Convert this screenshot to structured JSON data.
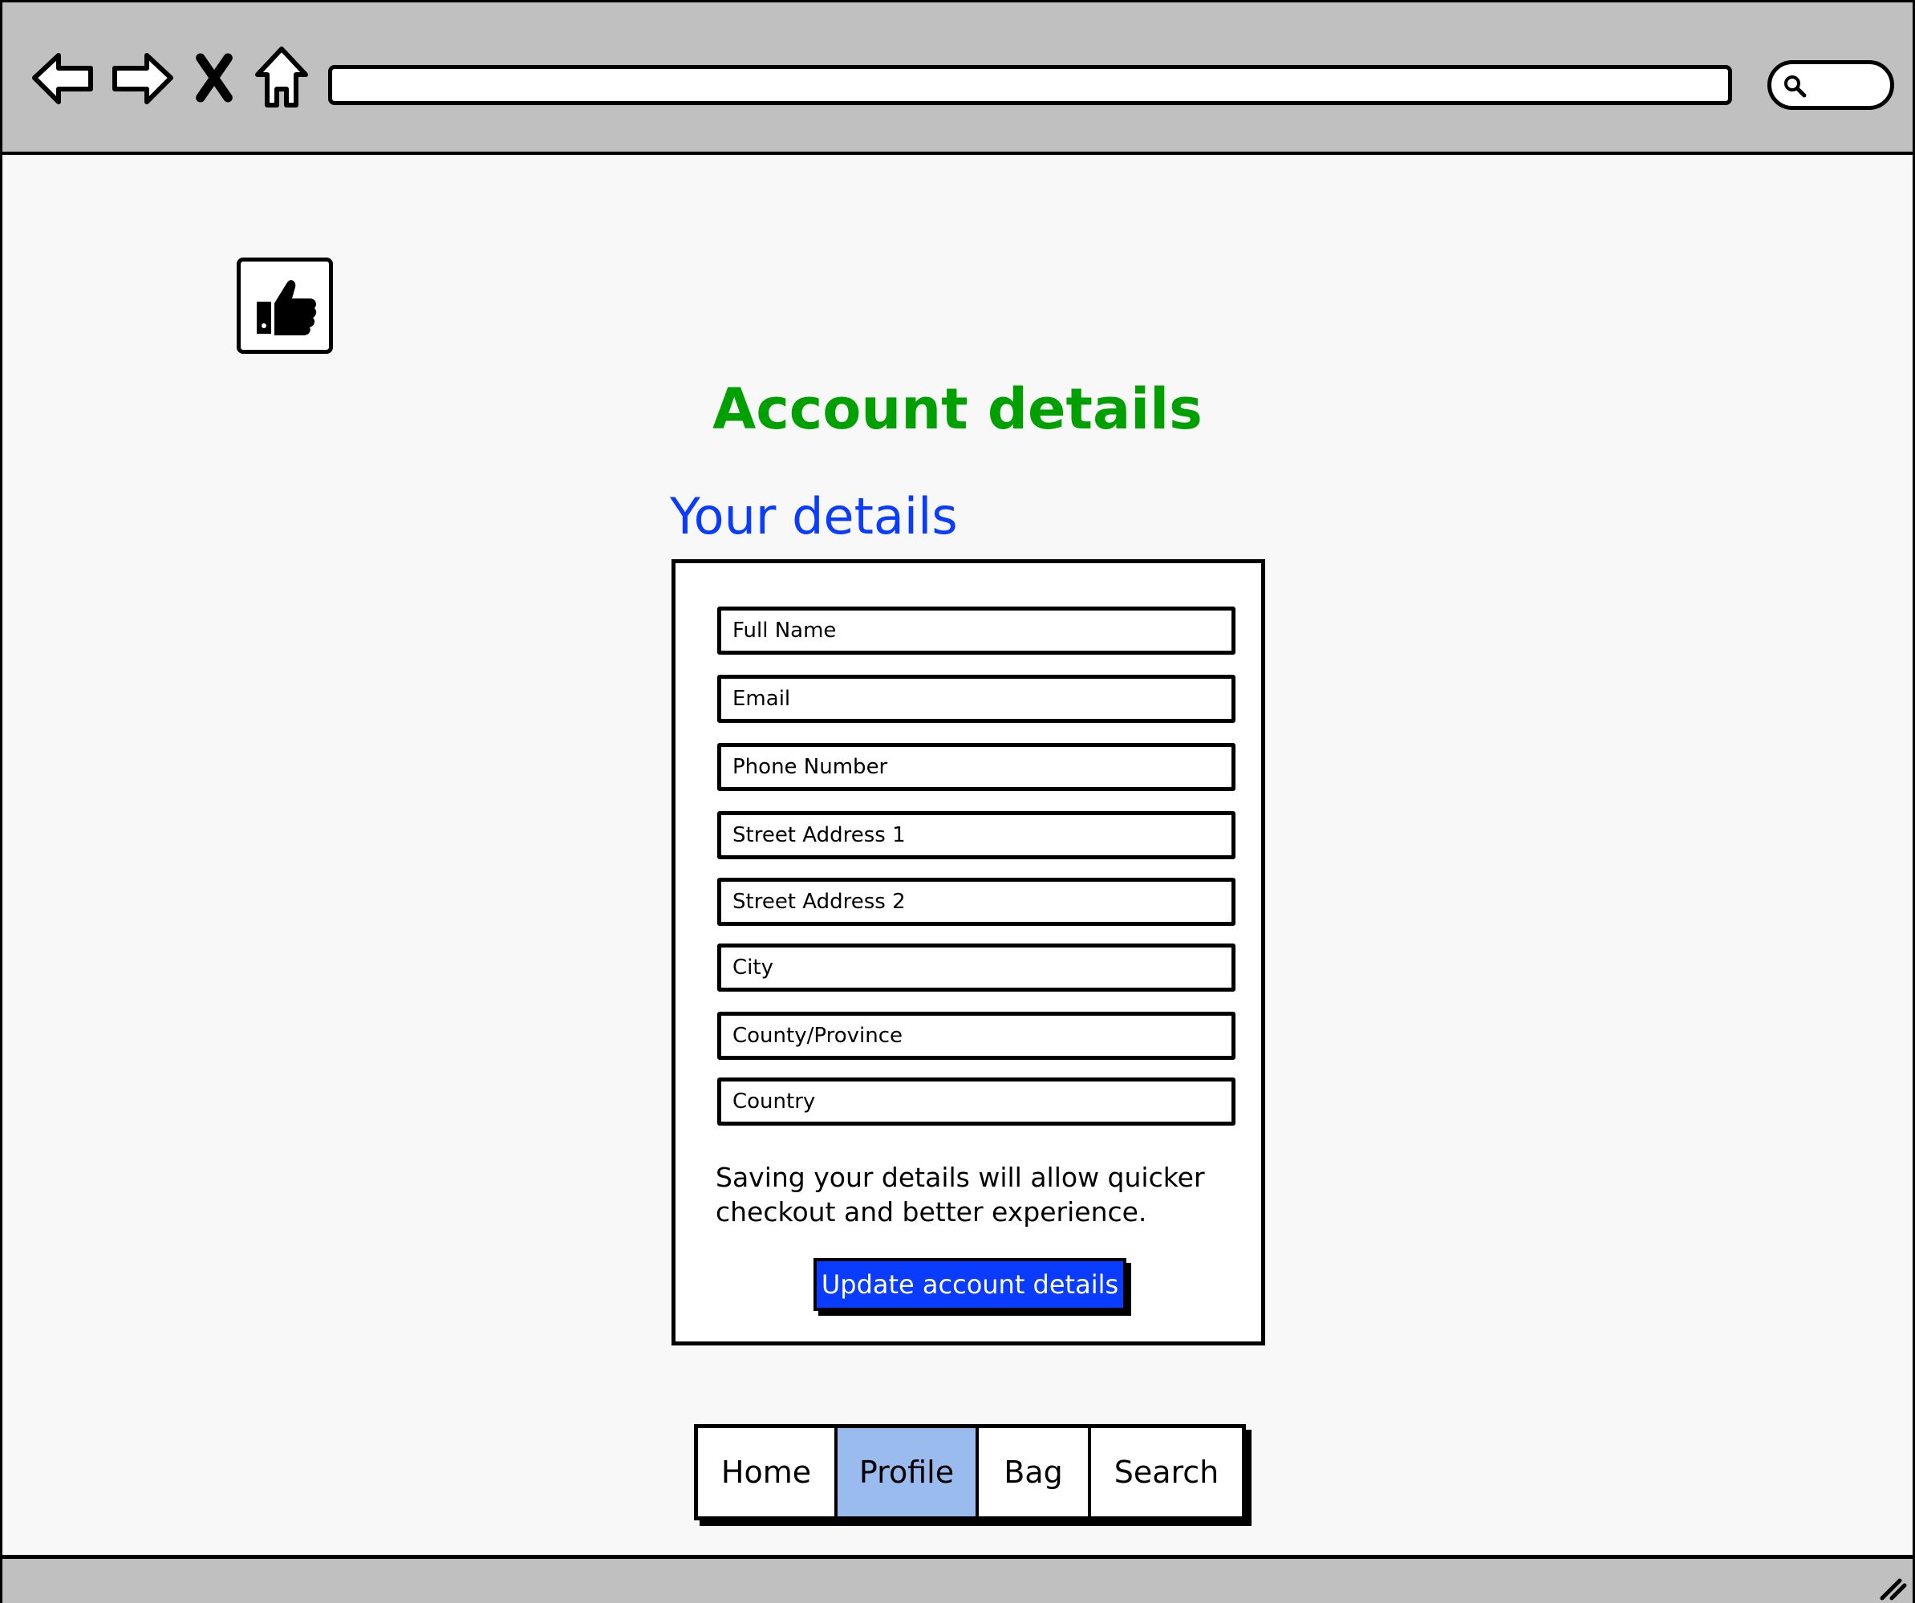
{
  "browser": {
    "address_value": "",
    "search_value": ""
  },
  "page": {
    "title": "Account details",
    "section_title": "Your details",
    "logo_icon": "thumbs-up-icon"
  },
  "form": {
    "fields": [
      {
        "placeholder": "Full Name"
      },
      {
        "placeholder": "Email"
      },
      {
        "placeholder": "Phone Number"
      },
      {
        "placeholder": "Street Address 1"
      },
      {
        "placeholder": "Street Address 2"
      },
      {
        "placeholder": "City"
      },
      {
        "placeholder": "County/Province"
      },
      {
        "placeholder": "Country"
      }
    ],
    "note": "Saving your details will allow quicker checkout and better experience.",
    "submit_label": "Update account details"
  },
  "nav": {
    "items": [
      {
        "label": "Home",
        "active": false
      },
      {
        "label": "Profile",
        "active": true
      },
      {
        "label": "Bag",
        "active": false
      },
      {
        "label": "Search",
        "active": false
      }
    ]
  },
  "colors": {
    "title": "#00a000",
    "section_title": "#0a3cff",
    "button": "#0a3cff",
    "active_tab": "#99bbee",
    "chrome": "#c0c0c0"
  }
}
